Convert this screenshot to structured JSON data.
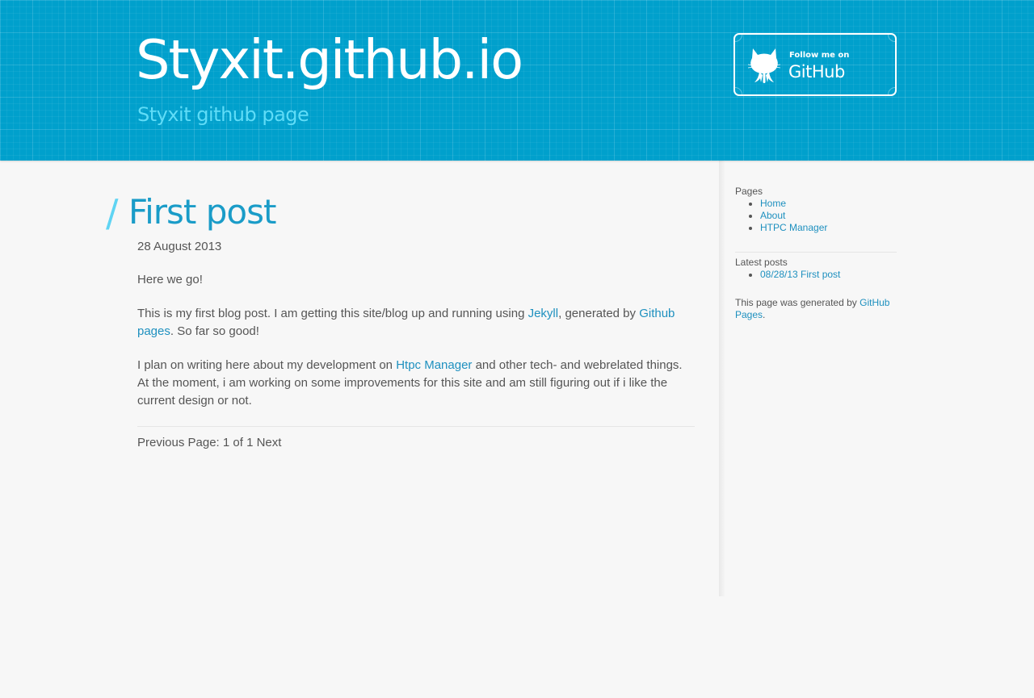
{
  "header": {
    "site_title": "Styxit.github.io",
    "tagline": "Styxit github page",
    "github_banner": {
      "small_text": "Follow me on",
      "big_text": "GitHub",
      "icon": "octocat-icon"
    },
    "background_color": "#00a0cc"
  },
  "post": {
    "title": "First post",
    "date": "28 August 2013",
    "paragraph1": "Here we go!",
    "paragraph2": {
      "text_before": "This is my first blog post. I am getting this site/blog up and running using ",
      "link1": "Jekyll",
      "text_middle": ", generated by ",
      "link2": "Github pages",
      "text_after": ". So far so good!"
    },
    "paragraph3": {
      "text_before": "I plan on writing here about my development on ",
      "link": "Htpc Manager",
      "text_after": " and other tech- and webrelated things. At the moment, i am working on some improvements for this site and am still figuring out if i like the current design or not."
    },
    "pagination": "Previous Page: 1 of 1 Next"
  },
  "sidebar": {
    "pages_heading": "Pages",
    "pages": [
      {
        "label": "Home"
      },
      {
        "label": "About"
      },
      {
        "label": "HTPC Manager"
      }
    ],
    "latest_heading": "Latest posts",
    "latest": [
      {
        "label": "08/28/13 First post"
      }
    ],
    "footer_text": "This page was generated by ",
    "footer_link": "GitHub Pages",
    "footer_end": "."
  },
  "colors": {
    "accent": "#1a9cc8",
    "link": "#1e90bf",
    "slash": "#5fd4f3",
    "tagline": "#5fdcf7",
    "page_background": "#f7f7f7"
  }
}
